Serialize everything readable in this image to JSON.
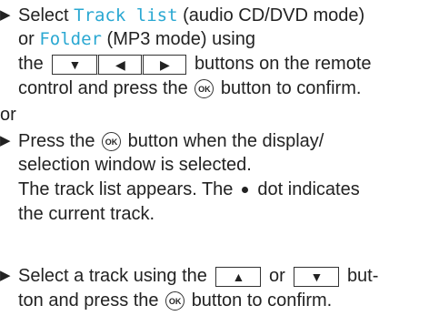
{
  "step1": {
    "bullet": "▶",
    "l1_pre": "Select ",
    "l1_track": "Track list",
    "l1_post": " (audio CD/DVD mode)",
    "l2_pre": "or ",
    "l2_folder": "Folder",
    "l2_post": " (MP3 mode) using",
    "l3_pre": "the",
    "keys": [
      "▼",
      "◀",
      "▶"
    ],
    "l3_post": "buttons on the remote",
    "l4_pre": "control and press the",
    "ok": "OK",
    "l4_post": "button to confirm."
  },
  "or_text": "or",
  "step2": {
    "bullet": "▶",
    "l1_pre": "Press the",
    "ok": "OK",
    "l1_post": "button when the display/",
    "l2": "selection window is selected.",
    "l3_pre": "The track list appears. The",
    "l3_post": "dot indicates",
    "l4": "the current track."
  },
  "step3": {
    "bullet": "▶",
    "l1_pre": "Select a track using the",
    "key_up": "▲",
    "l1_mid": "or",
    "key_down": "▼",
    "l1_post": "but-",
    "l2_pre": "ton and press the",
    "ok": "OK",
    "l2_post": "button to confirm."
  }
}
